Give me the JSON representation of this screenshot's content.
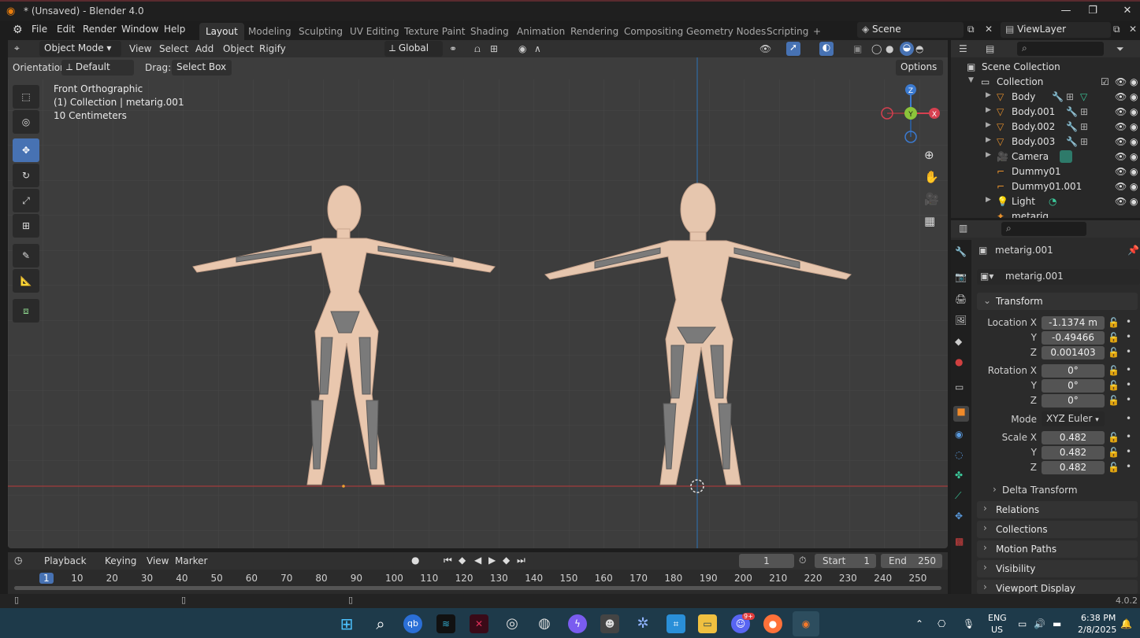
{
  "window": {
    "title": "* (Unsaved) - Blender 4.0",
    "min": "—",
    "max": "❐",
    "close": "✕"
  },
  "menu": [
    "File",
    "Edit",
    "Render",
    "Window",
    "Help"
  ],
  "workspaces": [
    "Layout",
    "Modeling",
    "Sculpting",
    "UV Editing",
    "Texture Paint",
    "Shading",
    "Animation",
    "Rendering",
    "Compositing",
    "Geometry Nodes",
    "Scripting",
    "+"
  ],
  "scene": {
    "label": "Scene",
    "viewlayer": "ViewLayer"
  },
  "viewport_header": {
    "mode": "Object Mode",
    "menus": [
      "View",
      "Select",
      "Add",
      "Object",
      "Rigify"
    ],
    "transform": "Global",
    "orientation_label": "Orientation:",
    "orientation_value": "Default",
    "drag_label": "Drag:",
    "drag_value": "Select Box",
    "options": "Options"
  },
  "viewport_info": {
    "view": "Front Orthographic",
    "collection": "(1) Collection | metarig.001",
    "scale": "10 Centimeters"
  },
  "gizmo": {
    "z": "Z",
    "y": "Y",
    "x": "X"
  },
  "outliner": {
    "root": "Scene Collection",
    "collection": "Collection",
    "items": [
      "Body",
      "Body.001",
      "Body.002",
      "Body.003",
      "Camera",
      "Dummy01",
      "Dummy01.001",
      "Light",
      "metarig"
    ]
  },
  "properties": {
    "object_name": "metarig.001",
    "data_name": "metarig.001",
    "transform_header": "Transform",
    "location_label": "Location X",
    "location": [
      "-1.1374 m",
      "-0.49466",
      "0.001403"
    ],
    "rotation_label": "Rotation X",
    "rotation": [
      "0°",
      "0°",
      "0°"
    ],
    "mode_label": "Mode",
    "mode_value": "XYZ Euler",
    "scale_label": "Scale X",
    "scale": [
      "0.482",
      "0.482",
      "0.482"
    ],
    "axis_y": "Y",
    "axis_z": "Z",
    "panels": [
      "Delta Transform",
      "Relations",
      "Collections",
      "Motion Paths",
      "Visibility",
      "Viewport Display"
    ]
  },
  "timeline": {
    "menus": [
      "Playback",
      "Keying",
      "View",
      "Marker"
    ],
    "current_frame": "1",
    "start_label": "Start",
    "start": "1",
    "end_label": "End",
    "end": "250",
    "ticks": [
      "1",
      "10",
      "20",
      "30",
      "40",
      "50",
      "60",
      "70",
      "80",
      "90",
      "100",
      "110",
      "120",
      "130",
      "140",
      "150",
      "160",
      "170",
      "180",
      "190",
      "200",
      "210",
      "220",
      "230",
      "240",
      "250"
    ]
  },
  "status": {
    "version": "4.0.2"
  },
  "taskbar": {
    "lang": "ENG",
    "region": "US",
    "time": "6:38 PM",
    "date": "2/8/2025",
    "badge": "9+"
  }
}
